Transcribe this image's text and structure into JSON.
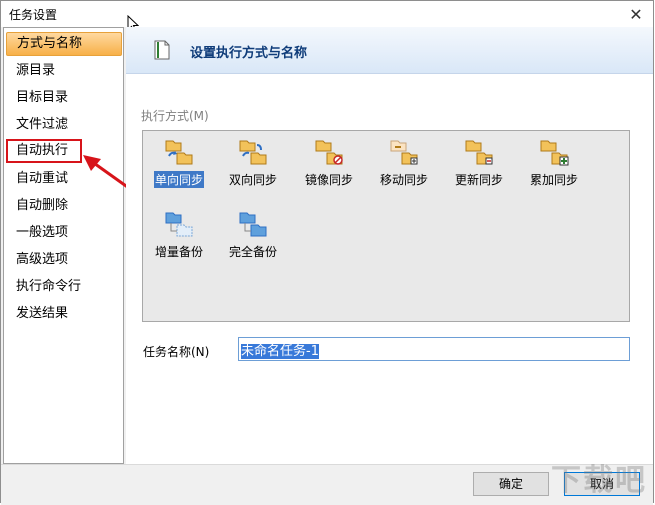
{
  "window": {
    "title": "任务设置"
  },
  "sidebar": {
    "items": [
      {
        "label": "方式与名称"
      },
      {
        "label": "源目录"
      },
      {
        "label": "目标目录"
      },
      {
        "label": "文件过滤"
      },
      {
        "label": "自动执行"
      },
      {
        "label": "自动重试"
      },
      {
        "label": "自动删除"
      },
      {
        "label": "一般选项"
      },
      {
        "label": "高级选项"
      },
      {
        "label": "执行命令行"
      },
      {
        "label": "发送结果"
      }
    ]
  },
  "header": {
    "title": "设置执行方式与名称"
  },
  "mode_group": {
    "label": "执行方式(M)",
    "modes": [
      {
        "label": "单向同步",
        "icon": "one-way-sync-icon"
      },
      {
        "label": "双向同步",
        "icon": "two-way-sync-icon"
      },
      {
        "label": "镜像同步",
        "icon": "mirror-sync-icon"
      },
      {
        "label": "移动同步",
        "icon": "move-sync-icon"
      },
      {
        "label": "更新同步",
        "icon": "update-sync-icon"
      },
      {
        "label": "累加同步",
        "icon": "accumulate-sync-icon"
      },
      {
        "label": "增量备份",
        "icon": "incremental-backup-icon"
      },
      {
        "label": "完全备份",
        "icon": "full-backup-icon"
      }
    ],
    "selected": "单向同步"
  },
  "task_name": {
    "label": "任务名称(N)",
    "value": "未命名任务-1"
  },
  "footer": {
    "ok_label": "确定",
    "cancel_label": "取消"
  },
  "watermark": "下载吧"
}
